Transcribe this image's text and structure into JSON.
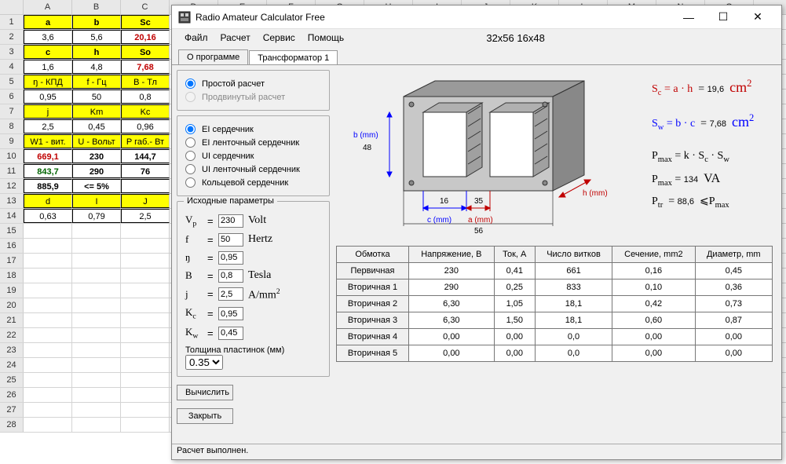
{
  "excel": {
    "cols": [
      "A",
      "B",
      "C",
      "D",
      "E",
      "F",
      "G",
      "H",
      "I",
      "J",
      "K",
      "L",
      "M",
      "N",
      "O"
    ],
    "rows": [
      {
        "n": 1,
        "a": "a",
        "b": "b",
        "c": "Sc",
        "style": "yellow bold"
      },
      {
        "n": 2,
        "a": "3,6",
        "b": "5,6",
        "c": "20,16",
        "cclass": "red bold"
      },
      {
        "n": 3,
        "a": "c",
        "b": "h",
        "c": "So",
        "style": "yellow bold"
      },
      {
        "n": 4,
        "a": "1,6",
        "b": "4,8",
        "c": "7,68",
        "cclass": "red bold"
      },
      {
        "n": 5,
        "a": "ŋ - КПД",
        "b": "f - Гц",
        "c": "B - Тл",
        "style": "yellow"
      },
      {
        "n": 6,
        "a": "0,95",
        "b": "50",
        "c": "0,8"
      },
      {
        "n": 7,
        "a": "j",
        "b": "Km",
        "c": "Kc",
        "style": "yellow"
      },
      {
        "n": 8,
        "a": "2,5",
        "b": "0,45",
        "c": "0,96"
      },
      {
        "n": 9,
        "a": "W1 - вит.",
        "b": "U - Вольт",
        "c": "P габ.- Вт",
        "style": "yellow"
      },
      {
        "n": 10,
        "a": "669,1",
        "b": "230",
        "c": "144,7",
        "aclass": "red bold",
        "bclass": "bold",
        "cclass": "bold"
      },
      {
        "n": 11,
        "a": "843,7",
        "b": "290",
        "c": "76",
        "aclass": "green bold",
        "bclass": "bold",
        "cclass": "bold"
      },
      {
        "n": 12,
        "a": "885,9",
        "b": "<= 5%",
        "c": "",
        "aclass": "bold",
        "bclass": "bold"
      },
      {
        "n": 13,
        "a": "d",
        "b": "I",
        "c": "J",
        "style": "yellow"
      },
      {
        "n": 14,
        "a": "0,63",
        "b": "0,79",
        "c": "2,5"
      }
    ]
  },
  "window": {
    "title": "Radio Amateur Calculator Free",
    "menu": [
      "Файл",
      "Расчет",
      "Сервис",
      "Помощь"
    ],
    "subtitle": "32x56 16x48",
    "tabs": [
      "О программе",
      "Трансформатор 1"
    ],
    "activeTab": 1,
    "status": "Расчет выполнен."
  },
  "calc_mode": {
    "simple": "Простой расчет",
    "advanced": "Продвинутый расчет"
  },
  "core_types": [
    "EI сердечник",
    "EI ленточный сердечник",
    "UI сердечник",
    "UI ленточный сердечник",
    "Кольцевой сердечник"
  ],
  "params": {
    "legend": "Исходные параметры",
    "vp": {
      "sym": "Vₚ",
      "val": "230",
      "unit": "Volt"
    },
    "f": {
      "sym": "f",
      "val": "50",
      "unit": "Hertz"
    },
    "eta": {
      "sym": "ŋ",
      "val": "0,95",
      "unit": ""
    },
    "b": {
      "sym": "B",
      "val": "0,8",
      "unit": "Tesla"
    },
    "j": {
      "sym": "j",
      "val": "2,5",
      "unit": "A/mm²"
    },
    "kc": {
      "sym": "Kc",
      "val": "0,95",
      "unit": ""
    },
    "kw": {
      "sym": "Kw",
      "val": "0,45",
      "unit": ""
    },
    "thickness_label": "Толщина пластинок (мм)",
    "thickness_value": "0.35"
  },
  "buttons": {
    "compute": "Вычислить",
    "close": "Закрыть"
  },
  "diagram": {
    "b_label": "b (mm)",
    "b_val": "48",
    "c_label": "c (mm)",
    "c_val": "16",
    "a_label": "a (mm)",
    "a_val": "35",
    "h_label": "h (mm)",
    "h_val": "56"
  },
  "formulas": {
    "sc_lhs": "Sc",
    "sc_rhs": "= a · h",
    "sc_eq": "=",
    "sc_val": "19,6",
    "sc_unit": "cm²",
    "sw_lhs": "Sw",
    "sw_rhs": "= b · c",
    "sw_eq": "=",
    "sw_val": "7,68",
    "sw_unit": "cm²",
    "pmax1": "Pmax = k · Sc · Sw",
    "pmax2_lhs": "Pmax",
    "pmax2_eq": "=",
    "pmax2_val": "134",
    "pmax2_unit": "VA",
    "ptr_lhs": "Ptr",
    "ptr_eq": "=",
    "ptr_val": "88,6",
    "ptr_rel": "⩽Pmax"
  },
  "table": {
    "headers": [
      "Обмотка",
      "Напряжение, В",
      "Ток, А",
      "Число витков",
      "Сечение, mm2",
      "Диаметр, mm"
    ],
    "rows": [
      [
        "Первичная",
        "230",
        "0,41",
        "661",
        "0,16",
        "0,45"
      ],
      [
        "Вторичная 1",
        "290",
        "0,25",
        "833",
        "0,10",
        "0,36"
      ],
      [
        "Вторичная 2",
        "6,30",
        "1,05",
        "18,1",
        "0,42",
        "0,73"
      ],
      [
        "Вторичная 3",
        "6,30",
        "1,50",
        "18,1",
        "0,60",
        "0,87"
      ],
      [
        "Вторичная 4",
        "0,00",
        "0,00",
        "0,0",
        "0,00",
        "0,00"
      ],
      [
        "Вторичная 5",
        "0,00",
        "0,00",
        "0,0",
        "0,00",
        "0,00"
      ]
    ]
  }
}
